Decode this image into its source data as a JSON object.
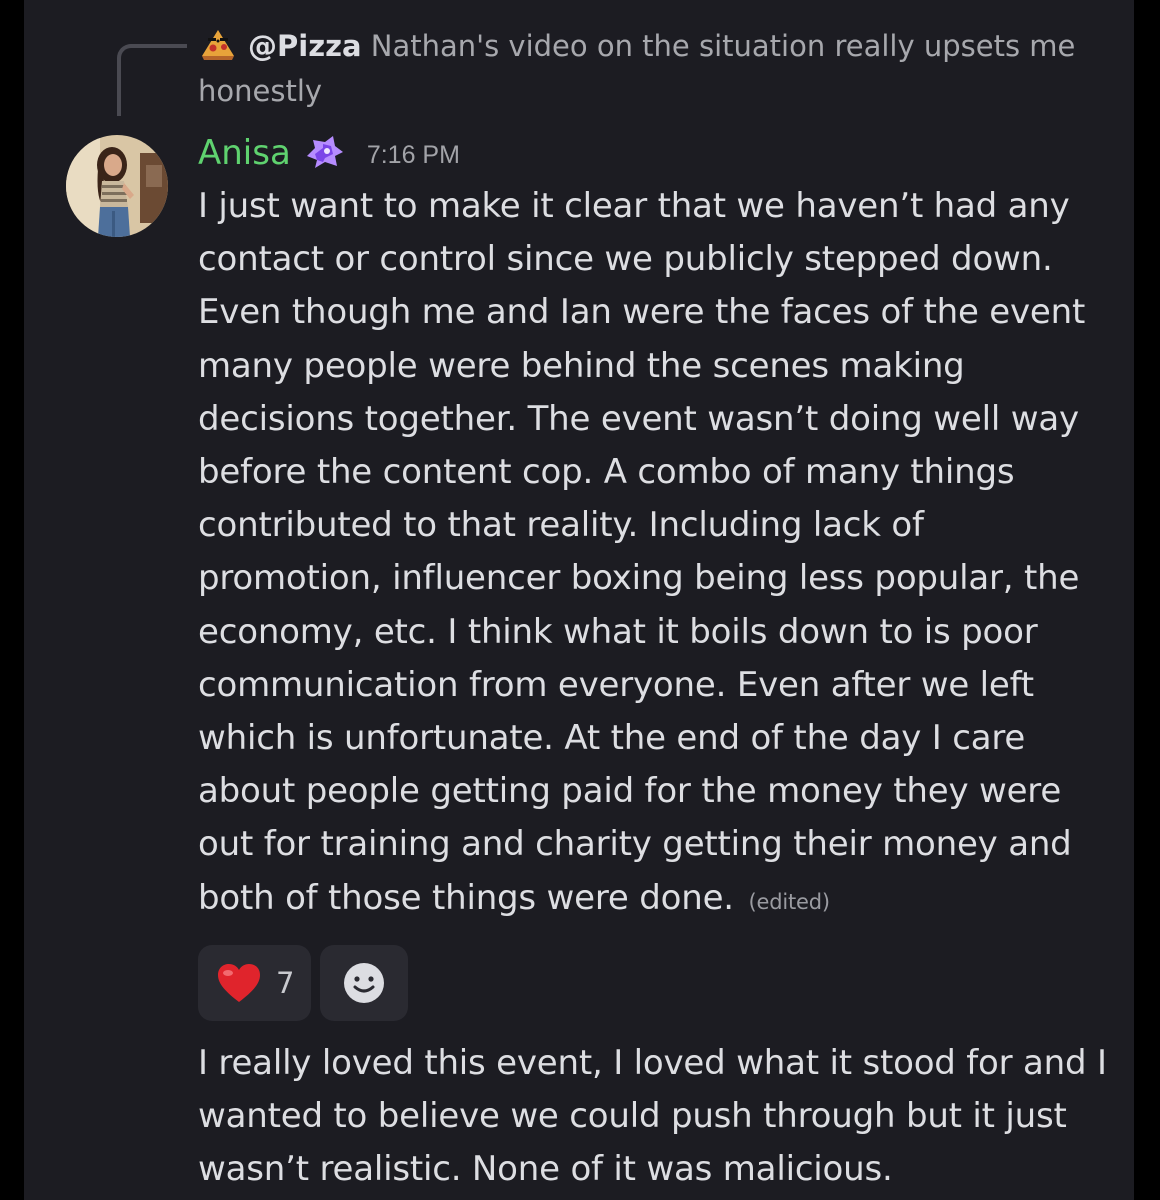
{
  "reply": {
    "mention": "@Pizza",
    "text": "Nathan's video on the situation really upsets me honestly",
    "icon": "pizza-avatar-icon"
  },
  "message": {
    "username": "Anisa",
    "username_color": "#5fd26f",
    "badge_icon": "nitro-badge-icon",
    "timestamp": "7:16 PM",
    "body": "I just want to make it clear that we haven’t had any contact or control since we publicly stepped down. Even though me and Ian were the faces of the event many people were behind the scenes making decisions together. The event wasn’t doing well way before the content cop. A combo of many things contributed to that reality. Including lack of promotion, influencer boxing being less popular, the economy,  etc. I think what it boils down to is poor communication from everyone. Even after we left which is unfortunate. At the end of the day I care about people getting paid for the money they were out for training and charity getting their money and both of those things were done.",
    "edited_label": "(edited)"
  },
  "reactions": [
    {
      "emoji": "❤️",
      "count": "7"
    }
  ],
  "add_reaction_icon": "add-reaction-smiley-icon",
  "followup": {
    "body": "I really loved this event, I loved what it stood for and I wanted to believe we could push through but it just wasn’t realistic. None of it was malicious."
  },
  "colors": {
    "background": "#1c1c22",
    "text": "#dddee2",
    "muted": "#a7a8ad",
    "reaction_bg": "#2a2a31"
  }
}
